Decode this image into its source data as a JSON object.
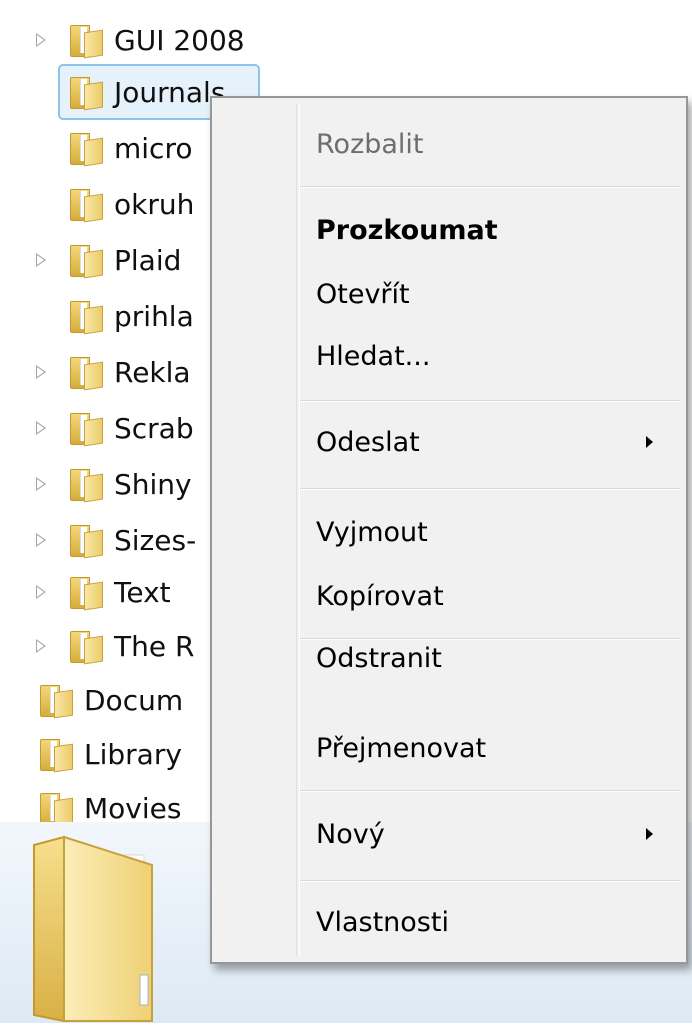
{
  "tree": {
    "items": [
      {
        "label": "GUI 2008",
        "expander": true
      },
      {
        "label": "Journals",
        "expander": false,
        "selected": true
      },
      {
        "label": "micro",
        "expander": false
      },
      {
        "label": "okruh",
        "expander": false
      },
      {
        "label": "Plaid",
        "expander": true
      },
      {
        "label": "prihla",
        "expander": false
      },
      {
        "label": "Rekla",
        "expander": true
      },
      {
        "label": "Scrab",
        "expander": true
      },
      {
        "label": "Shiny",
        "expander": true
      },
      {
        "label": "Sizes-",
        "expander": true
      },
      {
        "label": "Text",
        "expander": true
      },
      {
        "label": "The R",
        "expander": true
      },
      {
        "label": "Docum",
        "expander": false
      },
      {
        "label": "Library",
        "expander": false
      },
      {
        "label": "Movies",
        "expander": false
      }
    ]
  },
  "context_menu": {
    "items": [
      {
        "label": "Rozbalit",
        "disabled": true
      },
      {
        "label": "Prozkoumat",
        "bold": true
      },
      {
        "label": "Otevřít"
      },
      {
        "label": "Hledat..."
      },
      {
        "label": "Odeslat",
        "submenu": true
      },
      {
        "label": "Vyjmout"
      },
      {
        "label": "Kopírovat"
      },
      {
        "label": "Odstranit"
      },
      {
        "label": "Přejmenovat"
      },
      {
        "label": "Nový",
        "submenu": true
      },
      {
        "label": "Vlastnosti"
      }
    ]
  },
  "icons": {
    "folder": "folder-icon",
    "expander": "triangle-right-icon",
    "submenu": "submenu-arrow-icon"
  },
  "colors": {
    "selection_bg": "#e6f2fb",
    "selection_border": "#8cc4ec",
    "menu_bg": "#f1f1f1",
    "disabled_text": "#6d6d6d"
  }
}
